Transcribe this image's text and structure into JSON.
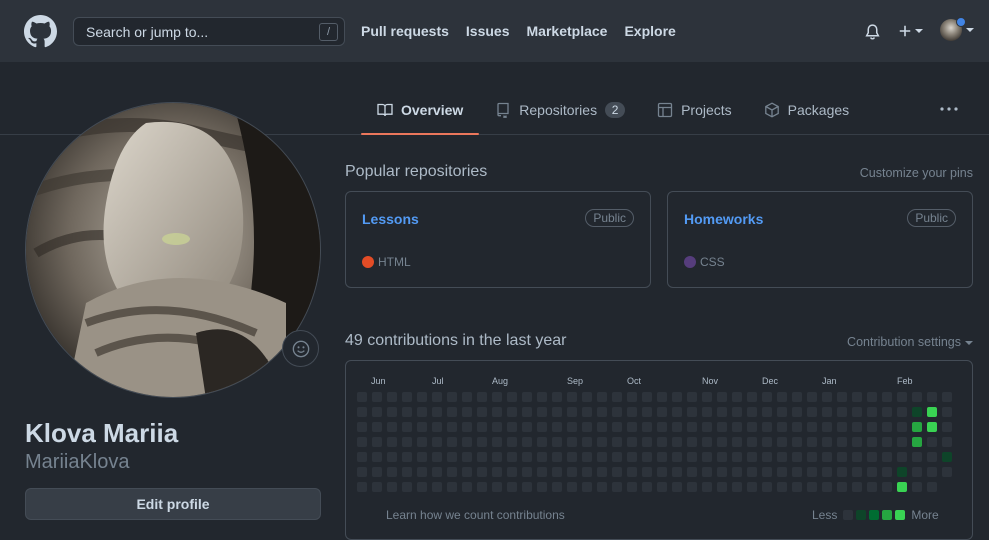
{
  "header": {
    "search_placeholder": "Search or jump to...",
    "search_key": "/",
    "nav": [
      "Pull requests",
      "Issues",
      "Marketplace",
      "Explore"
    ]
  },
  "tabs": [
    {
      "label": "Overview",
      "icon": "book-icon",
      "selected": true
    },
    {
      "label": "Repositories",
      "icon": "repo-icon",
      "count": "2"
    },
    {
      "label": "Projects",
      "icon": "project-icon"
    },
    {
      "label": "Packages",
      "icon": "package-icon"
    }
  ],
  "profile": {
    "fullname": "Klova Mariia",
    "username": "MariiaKlova",
    "edit_label": "Edit profile"
  },
  "popular": {
    "title": "Popular repositories",
    "customize": "Customize your pins",
    "repos": [
      {
        "name": "Lessons",
        "visibility": "Public",
        "language": "HTML",
        "lang_color": "#e34c26"
      },
      {
        "name": "Homeworks",
        "visibility": "Public",
        "language": "CSS",
        "lang_color": "#563d7c"
      }
    ]
  },
  "contributions": {
    "title": "49 contributions in the last year",
    "settings": "Contribution settings",
    "months": [
      "Jun",
      "Jul",
      "Aug",
      "Sep",
      "Oct",
      "Nov",
      "Dec",
      "Jan",
      "Feb"
    ],
    "learn": "Learn how we count contributions",
    "less": "Less",
    "more": "More",
    "colors": [
      "#2d333b",
      "#0e4429",
      "#006d32",
      "#26a641",
      "#39d353"
    ],
    "active_cells": [
      {
        "week": 37,
        "day": 1,
        "level": 1
      },
      {
        "week": 37,
        "day": 2,
        "level": 3
      },
      {
        "week": 37,
        "day": 3,
        "level": 3
      },
      {
        "week": 36,
        "day": 5,
        "level": 1
      },
      {
        "week": 36,
        "day": 6,
        "level": 4
      },
      {
        "week": 38,
        "day": 1,
        "level": 4
      },
      {
        "week": 38,
        "day": 2,
        "level": 4
      },
      {
        "week": 39,
        "day": 4,
        "level": 1
      }
    ],
    "total_weeks": 40,
    "last_week_days": 6
  }
}
